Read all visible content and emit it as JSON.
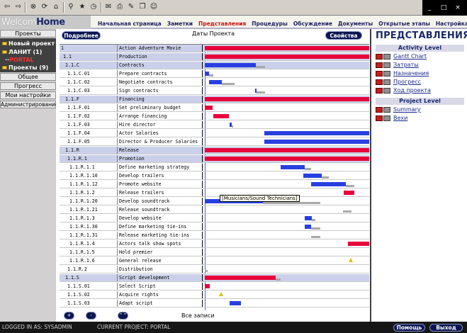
{
  "toolbar": {
    "icons": [
      "back-icon",
      "forward-icon",
      "stop-icon",
      "refresh-icon",
      "home-icon",
      "search-icon",
      "favorites-icon",
      "history-icon",
      "mail-icon",
      "print-icon",
      "edit-icon",
      "discuss-icon",
      "messenger-icon"
    ],
    "win_buttons": [
      "_",
      "□",
      "×"
    ]
  },
  "header": {
    "logo_light": "Welcom",
    "logo_bold": "Home",
    "nav": [
      "Начальная страница",
      "Заметки",
      "Представления",
      "Процедуры",
      "Обсуждение",
      "Документы",
      "Открытые этапы",
      "Настройка"
    ],
    "active_nav": "Представления"
  },
  "sidebar": {
    "projects_header": "Проекты",
    "tree": [
      {
        "label": "Новый проект"
      },
      {
        "label": "ЛАНИТ (1)"
      },
      {
        "label": "PORTAL",
        "active": true
      },
      {
        "label": "Проекты (9)"
      }
    ],
    "menu": [
      "Общее",
      "Прогресс",
      "Мои настройки",
      "Администрирование"
    ]
  },
  "main": {
    "details_button": "Подробнее",
    "title": "Даты Проекта",
    "properties_button": "Свойства",
    "tooltip": "[Musicians/Sound Technicians]",
    "all_records": "Все записи",
    "bottom_buttons": [
      "+",
      "-",
      "⌃⌃"
    ]
  },
  "gantt": {
    "rows": [
      {
        "id": "1",
        "name": "Action Adventure Movie",
        "summary": true
      },
      {
        "id": "1.1",
        "name": "Production",
        "summary": true
      },
      {
        "id": "1.1.C",
        "name": "Contracts",
        "summary": true
      },
      {
        "id": "1.1.C.01",
        "name": "Prepare contracts"
      },
      {
        "id": "1.1.C.02",
        "name": "Negotiate contracts"
      },
      {
        "id": "1.1.C.03",
        "name": "Sign contracts"
      },
      {
        "id": "1.1.F",
        "name": "Financing",
        "summary": true
      },
      {
        "id": "1.1.F.01",
        "name": "Set preliminary budget"
      },
      {
        "id": "1.1.F.02",
        "name": "Arrange financing"
      },
      {
        "id": "1.1.F.03",
        "name": "Hire director"
      },
      {
        "id": "1.1.F.04",
        "name": "Actor Salaries"
      },
      {
        "id": "1.1.F.05",
        "name": "Director & Producer Salaries"
      },
      {
        "id": "1.1.R",
        "name": "Release",
        "summary": true
      },
      {
        "id": "1.1.R.1",
        "name": "Promotion",
        "summary": true
      },
      {
        "id": "1.1.R.1.1",
        "name": "Define marketing strategy"
      },
      {
        "id": "1.1.R.1.10",
        "name": "Develop trailers"
      },
      {
        "id": "1.1.R.1.12",
        "name": "Promote website"
      },
      {
        "id": "1.1.R.1.2",
        "name": "Release trailers"
      },
      {
        "id": "1.1.R.1.20",
        "name": "Develop soundtrack"
      },
      {
        "id": "1.1.R.1.21",
        "name": "Release soundtrack"
      },
      {
        "id": "1.1.R.1.3",
        "name": "Develop website"
      },
      {
        "id": "1.1.R.1.30",
        "name": "Define marketing tie-ins"
      },
      {
        "id": "1.1.R.1.31",
        "name": "Release marketing tie-ins"
      },
      {
        "id": "1.1.R.1.4",
        "name": "Actors talk show spots"
      },
      {
        "id": "1.1.R.1.5",
        "name": "Hold premier"
      },
      {
        "id": "1.1.R.1.6",
        "name": "General release"
      },
      {
        "id": "1.1.R.2",
        "name": "Distribution"
      },
      {
        "id": "1.1.S",
        "name": "Script development",
        "summary": true
      },
      {
        "id": "1.1.S.01",
        "name": "Select Script"
      },
      {
        "id": "1.1.S.02",
        "name": "Acquire rights"
      },
      {
        "id": "1.1.S.03",
        "name": "Adapt script"
      }
    ]
  },
  "right_panel": {
    "title": "ПРЕДСТАВЛЕНИЯ",
    "activity_header": "Activity Level",
    "activity_links": [
      "Gantt Chart",
      "Затраты",
      "Назначения",
      "Прогресс",
      "Ход проекта"
    ],
    "project_header": "Project Level",
    "project_links": [
      "Summary",
      "Вехи"
    ]
  },
  "footer": {
    "logged_in": "LOGGED IN AS: SYSADMIN",
    "current_project": "CURRENT PROJECT: PORTAL",
    "help_button": "Помощь",
    "exit_button": "Выход"
  }
}
